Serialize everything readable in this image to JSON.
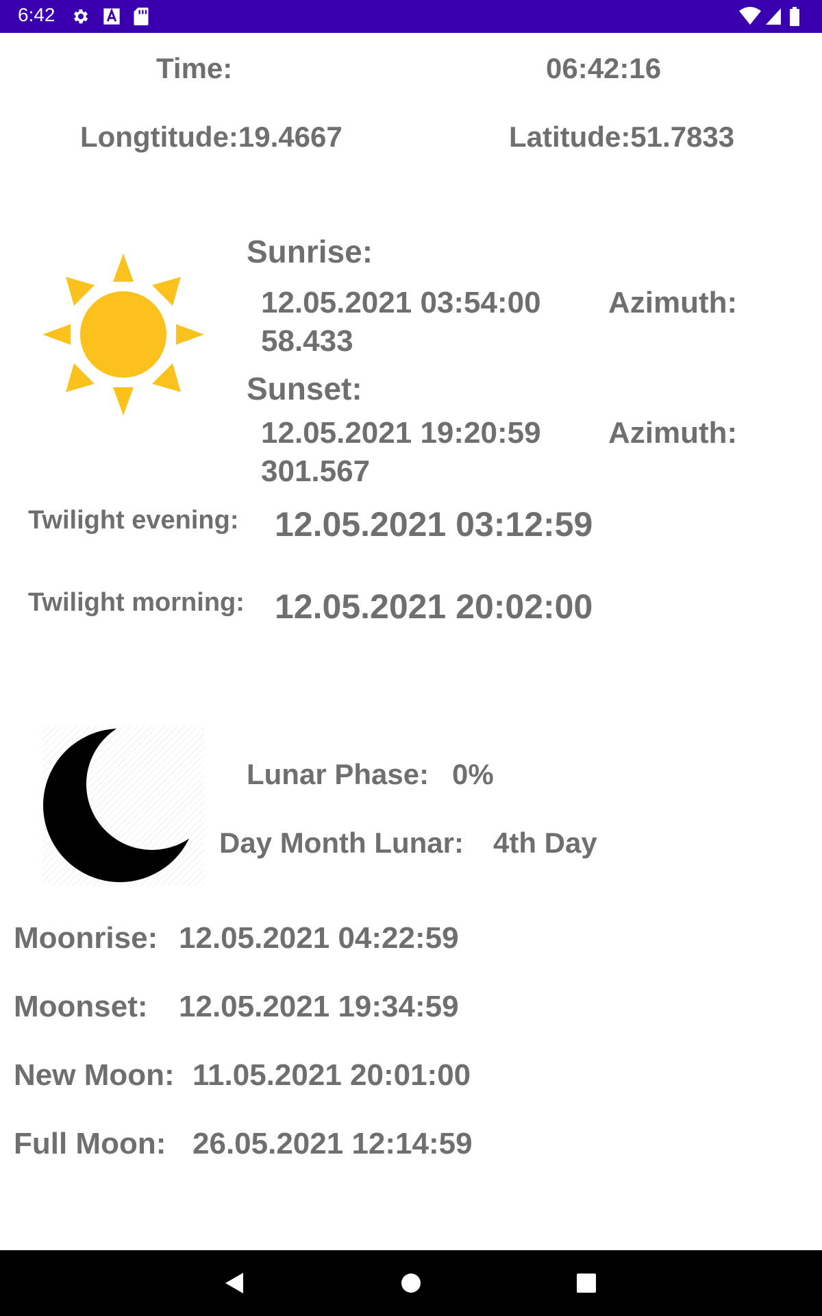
{
  "status_bar": {
    "time": "6:42",
    "icons": [
      "gear-icon",
      "keyboard-a-icon",
      "sd-card-icon",
      "wifi-icon",
      "signal-icon",
      "battery-icon"
    ]
  },
  "header": {
    "time_label": "Time:",
    "time_value": "06:42:16",
    "longitude": "Longtitude:19.4667",
    "latitude": "Latitude:51.7833"
  },
  "sun": {
    "icon": "sun-icon",
    "color": "#FBC21D",
    "sunrise_label": "Sunrise:",
    "sunrise_time": "12.05.2021 03:54:00",
    "sunrise_azimuth_label": "Azimuth:",
    "sunrise_azimuth_value": "58.433",
    "sunset_label": "Sunset:",
    "sunset_time": "12.05.2021 19:20:59",
    "sunset_azimuth_label": "Azimuth:",
    "sunset_azimuth_value": "301.567",
    "twilight_evening_label": "Twilight evening:",
    "twilight_evening_value": "12.05.2021 03:12:59",
    "twilight_morning_label": "Twilight morning:",
    "twilight_morning_value": "12.05.2021 20:02:00"
  },
  "moon": {
    "icon": "crescent-moon-icon",
    "lunar_phase_label": "Lunar Phase:",
    "lunar_phase_value": "0%",
    "day_month_lunar_label": "Day Month Lunar:",
    "day_month_lunar_value": "4th Day",
    "moonrise_label": "Moonrise:",
    "moonrise_value": "12.05.2021 04:22:59",
    "moonset_label": "Moonset:",
    "moonset_value": "12.05.2021 19:34:59",
    "new_moon_label": "New Moon:",
    "new_moon_value": "11.05.2021 20:01:00",
    "full_moon_label": "Full Moon:",
    "full_moon_value": "26.05.2021 12:14:59"
  },
  "nav_bar": {
    "icons": [
      "back-icon",
      "home-icon",
      "recents-icon"
    ]
  },
  "colors": {
    "status_bar": "#3A00B0",
    "text": "#6F6F6F",
    "sun": "#FBC21D",
    "nav_bar": "#000000"
  }
}
